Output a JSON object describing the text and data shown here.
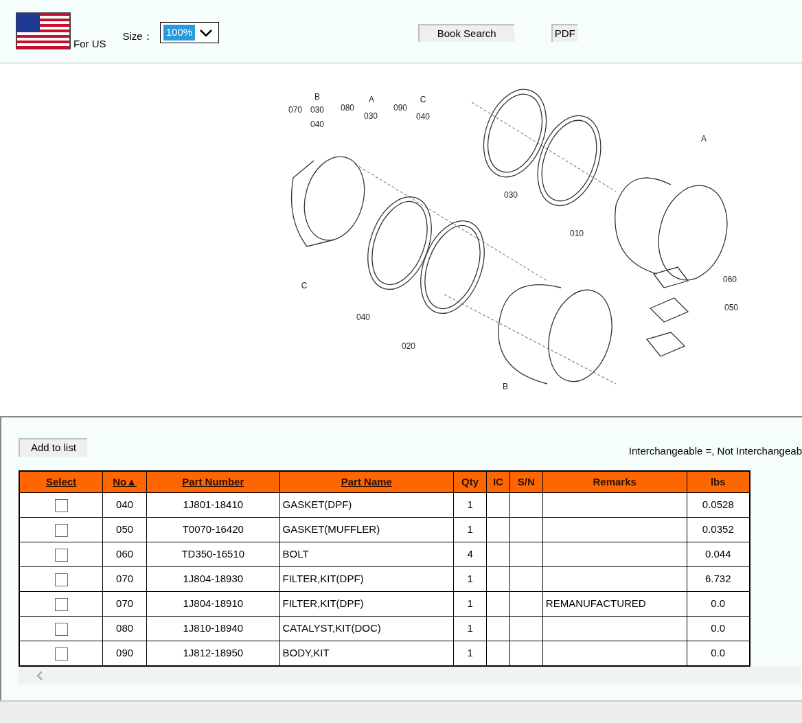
{
  "header": {
    "flag_caption": "For US",
    "size_label": "Size：",
    "size_value": "100%",
    "buttons": [
      "Book Search",
      "PDF"
    ]
  },
  "diagram": {
    "callouts": [
      "070",
      "B",
      "030",
      "040",
      "080",
      "A",
      "030",
      "090",
      "C",
      "040",
      "030",
      "010",
      "A",
      "060",
      "050",
      "C",
      "040",
      "020",
      "B"
    ]
  },
  "parts": {
    "add_button": "Add to list",
    "legend": "Interchangeable =, Not Interchangeab",
    "columns": [
      {
        "label": "Select",
        "sortable": true
      },
      {
        "label": "No▲",
        "sortable": true
      },
      {
        "label": "Part Number",
        "sortable": true
      },
      {
        "label": "Part Name",
        "sortable": true
      },
      {
        "label": "Qty",
        "sortable": false
      },
      {
        "label": "IC",
        "sortable": false
      },
      {
        "label": "S/N",
        "sortable": false
      },
      {
        "label": "Remarks",
        "sortable": false
      },
      {
        "label": "lbs",
        "sortable": false
      }
    ],
    "rows": [
      {
        "checked": false,
        "no": "040",
        "part_number": "1J801-18410",
        "part_name": "GASKET(DPF)",
        "qty": "1",
        "remarks": "",
        "lbs": "0.0528"
      },
      {
        "checked": false,
        "no": "050",
        "part_number": "T0070-16420",
        "part_name": "GASKET(MUFFLER)",
        "qty": "1",
        "remarks": "",
        "lbs": "0.0352"
      },
      {
        "checked": false,
        "no": "060",
        "part_number": "TD350-16510",
        "part_name": "BOLT",
        "qty": "4",
        "remarks": "",
        "lbs": "0.044"
      },
      {
        "checked": false,
        "no": "070",
        "part_number": "1J804-18930",
        "part_name": "FILTER,KIT(DPF)",
        "qty": "1",
        "remarks": "",
        "lbs": "6.732"
      },
      {
        "checked": false,
        "no": "070",
        "part_number": "1J804-18910",
        "part_name": "FILTER,KIT(DPF)",
        "qty": "1",
        "remarks": "REMANUFACTURED",
        "lbs": "0.0"
      },
      {
        "checked": false,
        "no": "080",
        "part_number": "1J810-18940",
        "part_name": "CATALYST,KIT(DOC)",
        "qty": "1",
        "remarks": "",
        "lbs": "0.0"
      },
      {
        "checked": false,
        "no": "090",
        "part_number": "1J812-18950",
        "part_name": "BODY,KIT",
        "qty": "1",
        "remarks": "",
        "lbs": "0.0"
      }
    ]
  }
}
